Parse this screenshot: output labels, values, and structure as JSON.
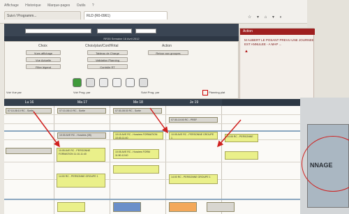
{
  "browser": {
    "menu": [
      "Affichage",
      "Historique",
      "Marque-pages",
      "Outils",
      "?"
    ],
    "tab1": "Suivi / Programm...",
    "tab2": "RLD (R0-0961)"
  },
  "header": {
    "caption": "RR35 Semaine 16 Avril 2012"
  },
  "panel": {
    "group_choice": "Choix",
    "group_planning": "Choix/plan/Conf/Rrtal",
    "group_action": "Action",
    "buttons_left": [
      "Vues affichage",
      "Vue Actuelle",
      "Filtre légend"
    ],
    "buttons_mid": [
      "Tableau de Charge",
      "Validation Planning",
      "Contrôle RT"
    ],
    "button_right": "Retour aux groupes",
    "filter_left": "Voir Vue par",
    "filter_mid1": "Voir Prog. par",
    "filter_mid2": "Suivi Prog. par",
    "filter_right": "Planning plat"
  },
  "alert": {
    "title": "Action",
    "text": "M AUBERT LE POSANT PREVU UNE JOURNEE EST ANNULEE - A MAP ..."
  },
  "calendar": {
    "days": [
      "Lu 16",
      "Ma 17",
      "Me 18",
      "Je 19"
    ],
    "events": [
      {
        "text": "07:10-08:10 RC - Sortie"
      },
      {
        "text": "07:10-08:10 RC - Sortie"
      },
      {
        "text": "07:30-08:30 RC - Sortie"
      },
      {
        "text": "07:30-10:00 RC - PREF"
      },
      {
        "text": "10:30 AVE RC - Horaires (05)"
      },
      {
        "text": "10:15 AVE RC - Horaires FORMATION 10:40-11:40"
      },
      {
        "text": "10:05 AVE RC - PERSONNE FORMATION 11:10-11:40"
      },
      {
        "text": "10:05 AVE RC - PERSONNE GROUPE 1"
      },
      {
        "text": "10:05 AVE RC - Horaires FORM 11:50-12:40"
      },
      {
        "text": "14:00 RC - PERSONNE GROUPE 1"
      },
      {
        "text": "14:00 RC - PERSONNE GROUPE 1"
      },
      {
        "text": "14:05 RC - PERSONNE"
      }
    ]
  },
  "photo": {
    "screen_text": "NNAGE"
  }
}
